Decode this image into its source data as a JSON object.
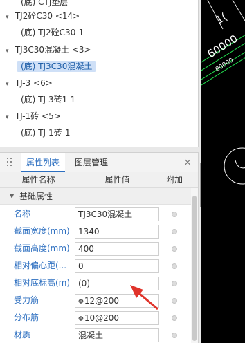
{
  "tree": {
    "items": [
      {
        "label": "(底) CTJ垫层",
        "level": 1
      },
      {
        "label": "TJ2砼C30 <14>",
        "level": 0
      },
      {
        "label": "(底) TJ2砼C30-1",
        "level": 1
      },
      {
        "label": "TJ3C30混凝土 <3>",
        "level": 0
      },
      {
        "label": "(底) TJ3C30混凝土",
        "level": 1,
        "selected": true
      },
      {
        "label": "TJ-3 <6>",
        "level": 0
      },
      {
        "label": "(底) TJ-3砖1-1",
        "level": 1
      },
      {
        "label": "TJ-1砖 <5>",
        "level": 0
      },
      {
        "label": "(底) TJ-1砖-1",
        "level": 1
      }
    ]
  },
  "panel": {
    "tab_props": "属性列表",
    "tab_layers": "图层管理",
    "close": "×",
    "col_name": "属性名称",
    "col_value": "属性值",
    "col_extra": "附加",
    "group_label": "基础属性"
  },
  "props": [
    {
      "name": "名称",
      "value": "TJ3C30混凝土"
    },
    {
      "name": "截面宽度(mm)",
      "value": "1340"
    },
    {
      "name": "截面高度(mm)",
      "value": "400"
    },
    {
      "name": "相对偏心距(...",
      "value": "0"
    },
    {
      "name": "相对底标高(m)",
      "value": "(0)"
    },
    {
      "name": "受力筋",
      "rebar_symbol": "Φ",
      "value": "12@200"
    },
    {
      "name": "分布筋",
      "rebar_symbol": "Φ",
      "value": "10@200"
    },
    {
      "name": "材质",
      "value": "混凝土"
    }
  ],
  "cad": {
    "dim_1": "60000",
    "dim_2": "60000",
    "dim_top": "1("
  },
  "colors": {
    "accent": "#2d6fc0",
    "selection": "#cfe0f7",
    "cad_green": "#1fd64a",
    "arrow_red": "#e0332a"
  },
  "icons": {
    "collapse": "chevron-left-icon",
    "close": "close-icon",
    "grip": "drag-grip-icon",
    "group": "triangle-down-icon"
  }
}
